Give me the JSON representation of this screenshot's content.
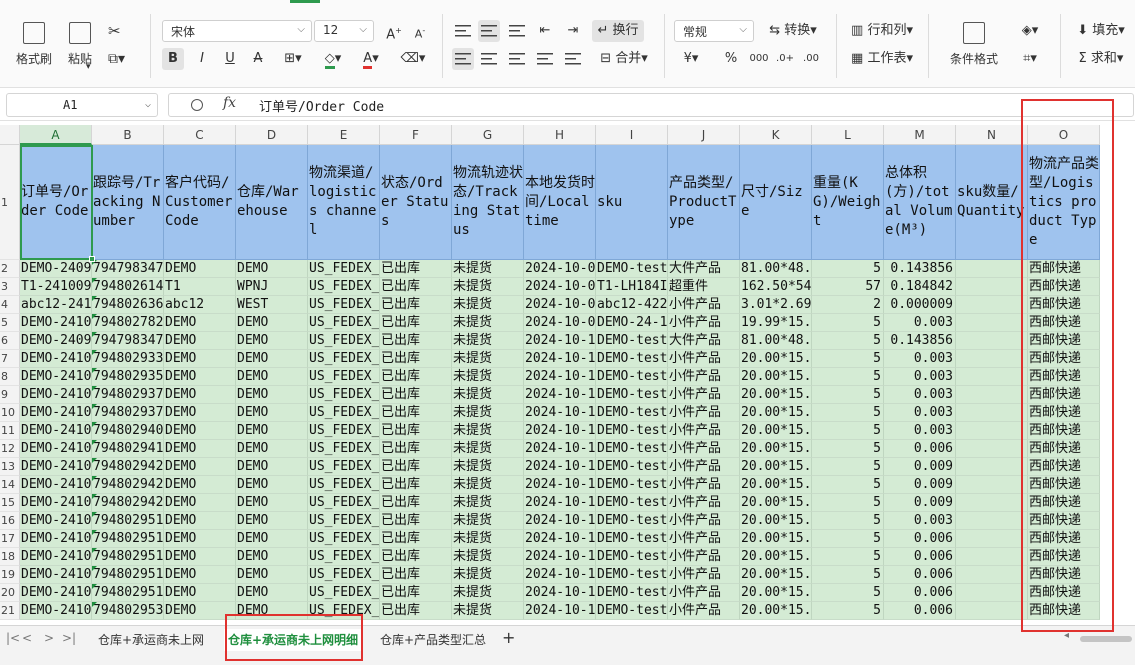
{
  "ribbon": {
    "format_painter": "格式刷",
    "paste": "粘贴",
    "font_name": "宋体",
    "font_size": "12",
    "grow_font": "A",
    "shrink_font": "A",
    "bold": "B",
    "italic": "I",
    "underline": "U",
    "strike": "A",
    "wrap_text": "换行",
    "merge": "合并",
    "number_format": "常规",
    "convert": "转换",
    "percent": "%",
    "rows_cols": "行和列",
    "worksheet": "工作表",
    "conditional_format": "条件格式",
    "fill": "填充",
    "sum": "求和"
  },
  "formula_bar": {
    "cell_ref": "A1",
    "fx": "fx",
    "value": "订单号/Order Code"
  },
  "grid": {
    "columns": [
      "A",
      "B",
      "C",
      "D",
      "E",
      "F",
      "G",
      "H",
      "I",
      "J",
      "K",
      "L",
      "M",
      "N",
      "O"
    ],
    "selected_column": "A",
    "header_row_number": "1",
    "headers": [
      "订单号/Order Code",
      "跟踪号/Tracking Number",
      "客户代码/CustomerCode",
      "仓库/Warehouse",
      "物流渠道/logistics channel",
      "状态/Order Status",
      "物流轨迹状态/Tracking Status",
      "本地发货时间/Local time",
      "sku",
      "产品类型/ProductType",
      "尺寸/Size",
      "重量(KG)/Weight",
      "总体积(方)/total Volume(M³)",
      "sku数量/Quantity",
      "物流产品类型/Logistics product Type"
    ],
    "rows": [
      {
        "n": "2",
        "cells": [
          "DEMO-2409",
          "794798347",
          "DEMO",
          "DEMO",
          "US_FEDEX_",
          "已出库",
          "未提货",
          "2024-10-0",
          "DEMO-test",
          "大件产品",
          "81.00*48.",
          "5",
          "0.143856",
          "",
          "西邮快递"
        ]
      },
      {
        "n": "3",
        "cells": [
          "T1-241009",
          "794802614",
          "T1",
          "WPNJ",
          "US_FEDEX_",
          "已出库",
          "未提货",
          "2024-10-0",
          "T1-LH184I",
          "超重件",
          "162.50*54",
          "57",
          "0.184842",
          "",
          "西邮快递"
        ]
      },
      {
        "n": "4",
        "cells": [
          "abc12-241",
          "794802636",
          "abc12",
          "WEST",
          "US_FEDEX_",
          "已出库",
          "未提货",
          "2024-10-0",
          "abc12-422",
          "小件产品",
          "3.01*2.69",
          "2",
          "0.000009",
          "",
          "西邮快递"
        ]
      },
      {
        "n": "5",
        "cells": [
          "DEMO-2410",
          "794802782",
          "DEMO",
          "DEMO",
          "US_FEDEX_",
          "已出库",
          "未提货",
          "2024-10-0",
          "DEMO-24-1",
          "小件产品",
          "19.99*15.",
          "5",
          "0.003",
          "",
          "西邮快递"
        ]
      },
      {
        "n": "6",
        "cells": [
          "DEMO-2409",
          "794798347",
          "DEMO",
          "DEMO",
          "US_FEDEX_",
          "已出库",
          "未提货",
          "2024-10-1",
          "DEMO-test",
          "大件产品",
          "81.00*48.",
          "5",
          "0.143856",
          "",
          "西邮快递"
        ]
      },
      {
        "n": "7",
        "cells": [
          "DEMO-2410",
          "794802933",
          "DEMO",
          "DEMO",
          "US_FEDEX_",
          "已出库",
          "未提货",
          "2024-10-1",
          "DEMO-test",
          "小件产品",
          "20.00*15.",
          "5",
          "0.003",
          "",
          "西邮快递"
        ]
      },
      {
        "n": "8",
        "cells": [
          "DEMO-2410",
          "794802935",
          "DEMO",
          "DEMO",
          "US_FEDEX_",
          "已出库",
          "未提货",
          "2024-10-1",
          "DEMO-test",
          "小件产品",
          "20.00*15.",
          "5",
          "0.003",
          "",
          "西邮快递"
        ]
      },
      {
        "n": "9",
        "cells": [
          "DEMO-2410",
          "794802937",
          "DEMO",
          "DEMO",
          "US_FEDEX_",
          "已出库",
          "未提货",
          "2024-10-1",
          "DEMO-test",
          "小件产品",
          "20.00*15.",
          "5",
          "0.003",
          "",
          "西邮快递"
        ]
      },
      {
        "n": "10",
        "cells": [
          "DEMO-2410",
          "794802937",
          "DEMO",
          "DEMO",
          "US_FEDEX_",
          "已出库",
          "未提货",
          "2024-10-1",
          "DEMO-test",
          "小件产品",
          "20.00*15.",
          "5",
          "0.003",
          "",
          "西邮快递"
        ]
      },
      {
        "n": "11",
        "cells": [
          "DEMO-2410",
          "794802940",
          "DEMO",
          "DEMO",
          "US_FEDEX_",
          "已出库",
          "未提货",
          "2024-10-1",
          "DEMO-test",
          "小件产品",
          "20.00*15.",
          "5",
          "0.003",
          "",
          "西邮快递"
        ]
      },
      {
        "n": "12",
        "cells": [
          "DEMO-2410",
          "794802941",
          "DEMO",
          "DEMO",
          "US_FEDEX_",
          "已出库",
          "未提货",
          "2024-10-1",
          "DEMO-test",
          "小件产品",
          "20.00*15.",
          "5",
          "0.006",
          "",
          "西邮快递"
        ]
      },
      {
        "n": "13",
        "cells": [
          "DEMO-2410",
          "794802942",
          "DEMO",
          "DEMO",
          "US_FEDEX_",
          "已出库",
          "未提货",
          "2024-10-1",
          "DEMO-test",
          "小件产品",
          "20.00*15.",
          "5",
          "0.009",
          "",
          "西邮快递"
        ]
      },
      {
        "n": "14",
        "cells": [
          "DEMO-2410",
          "794802942",
          "DEMO",
          "DEMO",
          "US_FEDEX_",
          "已出库",
          "未提货",
          "2024-10-1",
          "DEMO-test",
          "小件产品",
          "20.00*15.",
          "5",
          "0.009",
          "",
          "西邮快递"
        ]
      },
      {
        "n": "15",
        "cells": [
          "DEMO-2410",
          "794802942",
          "DEMO",
          "DEMO",
          "US_FEDEX_",
          "已出库",
          "未提货",
          "2024-10-1",
          "DEMO-test",
          "小件产品",
          "20.00*15.",
          "5",
          "0.009",
          "",
          "西邮快递"
        ]
      },
      {
        "n": "16",
        "cells": [
          "DEMO-2410",
          "794802951",
          "DEMO",
          "DEMO",
          "US_FEDEX_",
          "已出库",
          "未提货",
          "2024-10-1",
          "DEMO-test",
          "小件产品",
          "20.00*15.",
          "5",
          "0.003",
          "",
          "西邮快递"
        ]
      },
      {
        "n": "17",
        "cells": [
          "DEMO-2410",
          "794802951",
          "DEMO",
          "DEMO",
          "US_FEDEX_",
          "已出库",
          "未提货",
          "2024-10-1",
          "DEMO-test",
          "小件产品",
          "20.00*15.",
          "5",
          "0.006",
          "",
          "西邮快递"
        ]
      },
      {
        "n": "18",
        "cells": [
          "DEMO-2410",
          "794802951",
          "DEMO",
          "DEMO",
          "US_FEDEX_",
          "已出库",
          "未提货",
          "2024-10-1",
          "DEMO-test",
          "小件产品",
          "20.00*15.",
          "5",
          "0.006",
          "",
          "西邮快递"
        ]
      },
      {
        "n": "19",
        "cells": [
          "DEMO-2410",
          "794802951",
          "DEMO",
          "DEMO",
          "US_FEDEX_",
          "已出库",
          "未提货",
          "2024-10-1",
          "DEMO-test",
          "小件产品",
          "20.00*15.",
          "5",
          "0.006",
          "",
          "西邮快递"
        ]
      },
      {
        "n": "20",
        "cells": [
          "DEMO-2410",
          "794802951",
          "DEMO",
          "DEMO",
          "US_FEDEX_",
          "已出库",
          "未提货",
          "2024-10-1",
          "DEMO-test",
          "小件产品",
          "20.00*15.",
          "5",
          "0.006",
          "",
          "西邮快递"
        ]
      },
      {
        "n": "21",
        "cells": [
          "DEMO-2410",
          "794802953",
          "DEMO",
          "DEMO",
          "US_FEDEX_",
          "已出库",
          "未提货",
          "2024-10-1",
          "DEMO-test",
          "小件产品",
          "20.00*15.",
          "5",
          "0.006",
          "",
          "西邮快递"
        ]
      }
    ]
  },
  "sheet_tabs": {
    "nav": [
      "|<",
      "<",
      ">",
      ">|"
    ],
    "tabs": [
      "仓库+承运商未上网",
      "仓库+承运商未上网明细",
      "仓库+产品类型汇总"
    ],
    "active_index": 1,
    "add": "+"
  },
  "colors": {
    "accent": "#2e9a4e",
    "header_fill": "#9fc3ee",
    "cell_fill": "#d4ebd4",
    "annotation": "#e0322f"
  }
}
